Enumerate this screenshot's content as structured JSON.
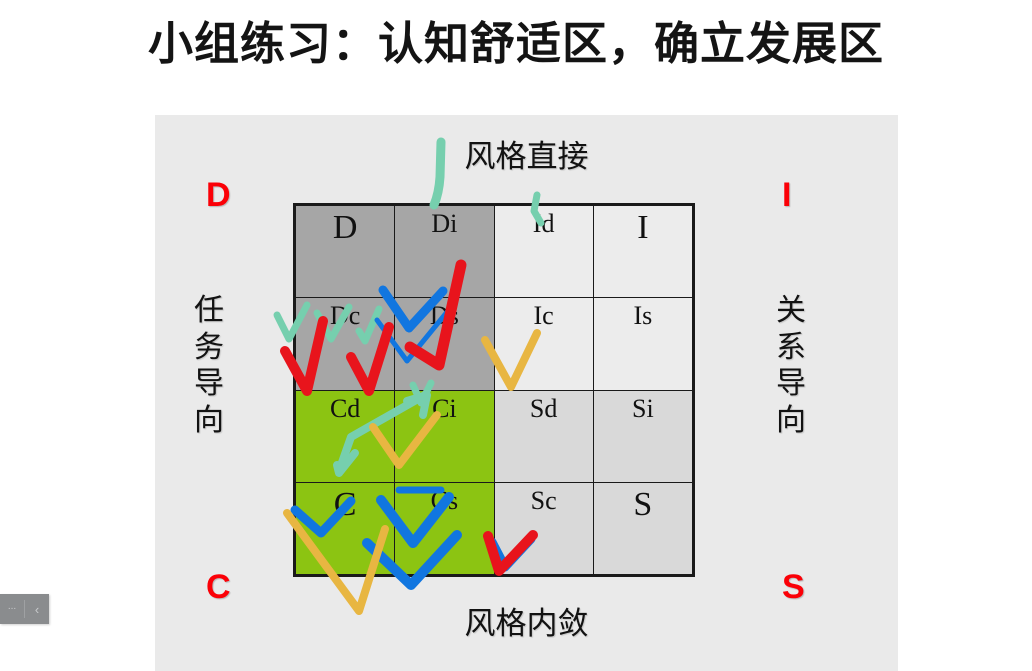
{
  "slide": {
    "title": "小组练习：认知舒适区，确立发展区"
  },
  "diagram": {
    "corners": {
      "top_left": "D",
      "top_right": "I",
      "bottom_left": "C",
      "bottom_right": "S"
    },
    "axis_labels": {
      "top": "风格直接",
      "bottom": "风格内敛",
      "left": "任务导向",
      "right": "关系导向"
    },
    "left_label_chars": [
      "任",
      "务",
      "导",
      "向"
    ],
    "right_label_chars": [
      "关",
      "系",
      "导",
      "向"
    ],
    "colors": {
      "corner_letter": "#fb0007",
      "cell_dark_gray": "#a6a6a6",
      "cell_light_gray": "#ececec",
      "cell_mid_gray": "#d9d9d9",
      "cell_green": "#8cc412",
      "panel_background": "#eaeaea",
      "ink_red": "#e8141c",
      "ink_blue": "#1176e0",
      "ink_green": "#76cfae",
      "ink_yellow": "#e8b642"
    },
    "matrix": {
      "rows": [
        [
          {
            "label": "D",
            "fill": "dark",
            "size": "lg"
          },
          {
            "label": "Di",
            "fill": "dark",
            "size": "md"
          },
          {
            "label": "Id",
            "fill": "light",
            "size": "md"
          },
          {
            "label": "I",
            "fill": "light",
            "size": "lg"
          }
        ],
        [
          {
            "label": "Dc",
            "fill": "dark",
            "size": "md"
          },
          {
            "label": "Ds",
            "fill": "dark",
            "size": "md"
          },
          {
            "label": "Ic",
            "fill": "light",
            "size": "md"
          },
          {
            "label": "Is",
            "fill": "light",
            "size": "md"
          }
        ],
        [
          {
            "label": "Cd",
            "fill": "green",
            "size": "md"
          },
          {
            "label": "Ci",
            "fill": "green",
            "size": "md"
          },
          {
            "label": "Sd",
            "fill": "mid",
            "size": "md"
          },
          {
            "label": "Si",
            "fill": "mid",
            "size": "md"
          }
        ],
        [
          {
            "label": "C",
            "fill": "green",
            "size": "lg"
          },
          {
            "label": "Cs",
            "fill": "green",
            "size": "md"
          },
          {
            "label": "Sc",
            "fill": "mid",
            "size": "md"
          },
          {
            "label": "S",
            "fill": "mid",
            "size": "lg"
          }
        ]
      ]
    }
  },
  "toolbar": {
    "more_label": "...",
    "prev_label": "‹"
  }
}
